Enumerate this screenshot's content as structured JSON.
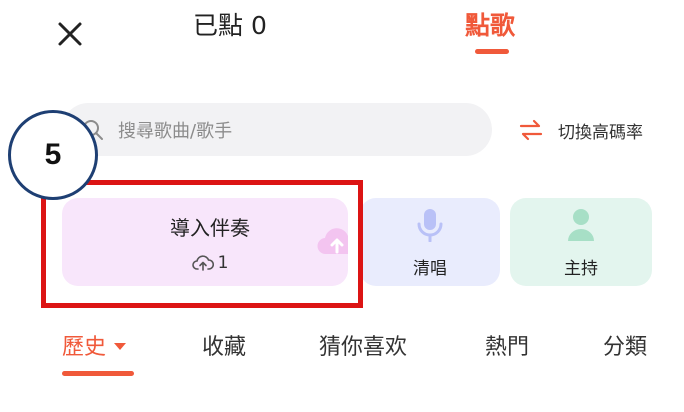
{
  "header": {
    "selected_label": "已點 0",
    "songs_tab_label": "點歌"
  },
  "search": {
    "placeholder": "搜尋歌曲/歌手"
  },
  "switch_rate": {
    "label": "切換高碼率"
  },
  "step_badge": {
    "number": "5"
  },
  "cards": {
    "import": {
      "title": "導入伴奏",
      "count": "1"
    },
    "acappella": {
      "label": "清唱"
    },
    "host": {
      "label": "主持"
    }
  },
  "categories": {
    "history": "歷史",
    "favorites": "收藏",
    "guess": "猜你喜欢",
    "popular": "熱門",
    "classify": "分類"
  },
  "colors": {
    "accent": "#f0593a",
    "highlight": "#dc1414",
    "badge_border": "#1e3f73"
  },
  "icons": {
    "close": "close-icon",
    "search": "search-icon",
    "switch": "switch-arrows-icon",
    "cloud_upload": "cloud-upload-icon",
    "microphone": "microphone-icon",
    "person": "person-icon"
  }
}
